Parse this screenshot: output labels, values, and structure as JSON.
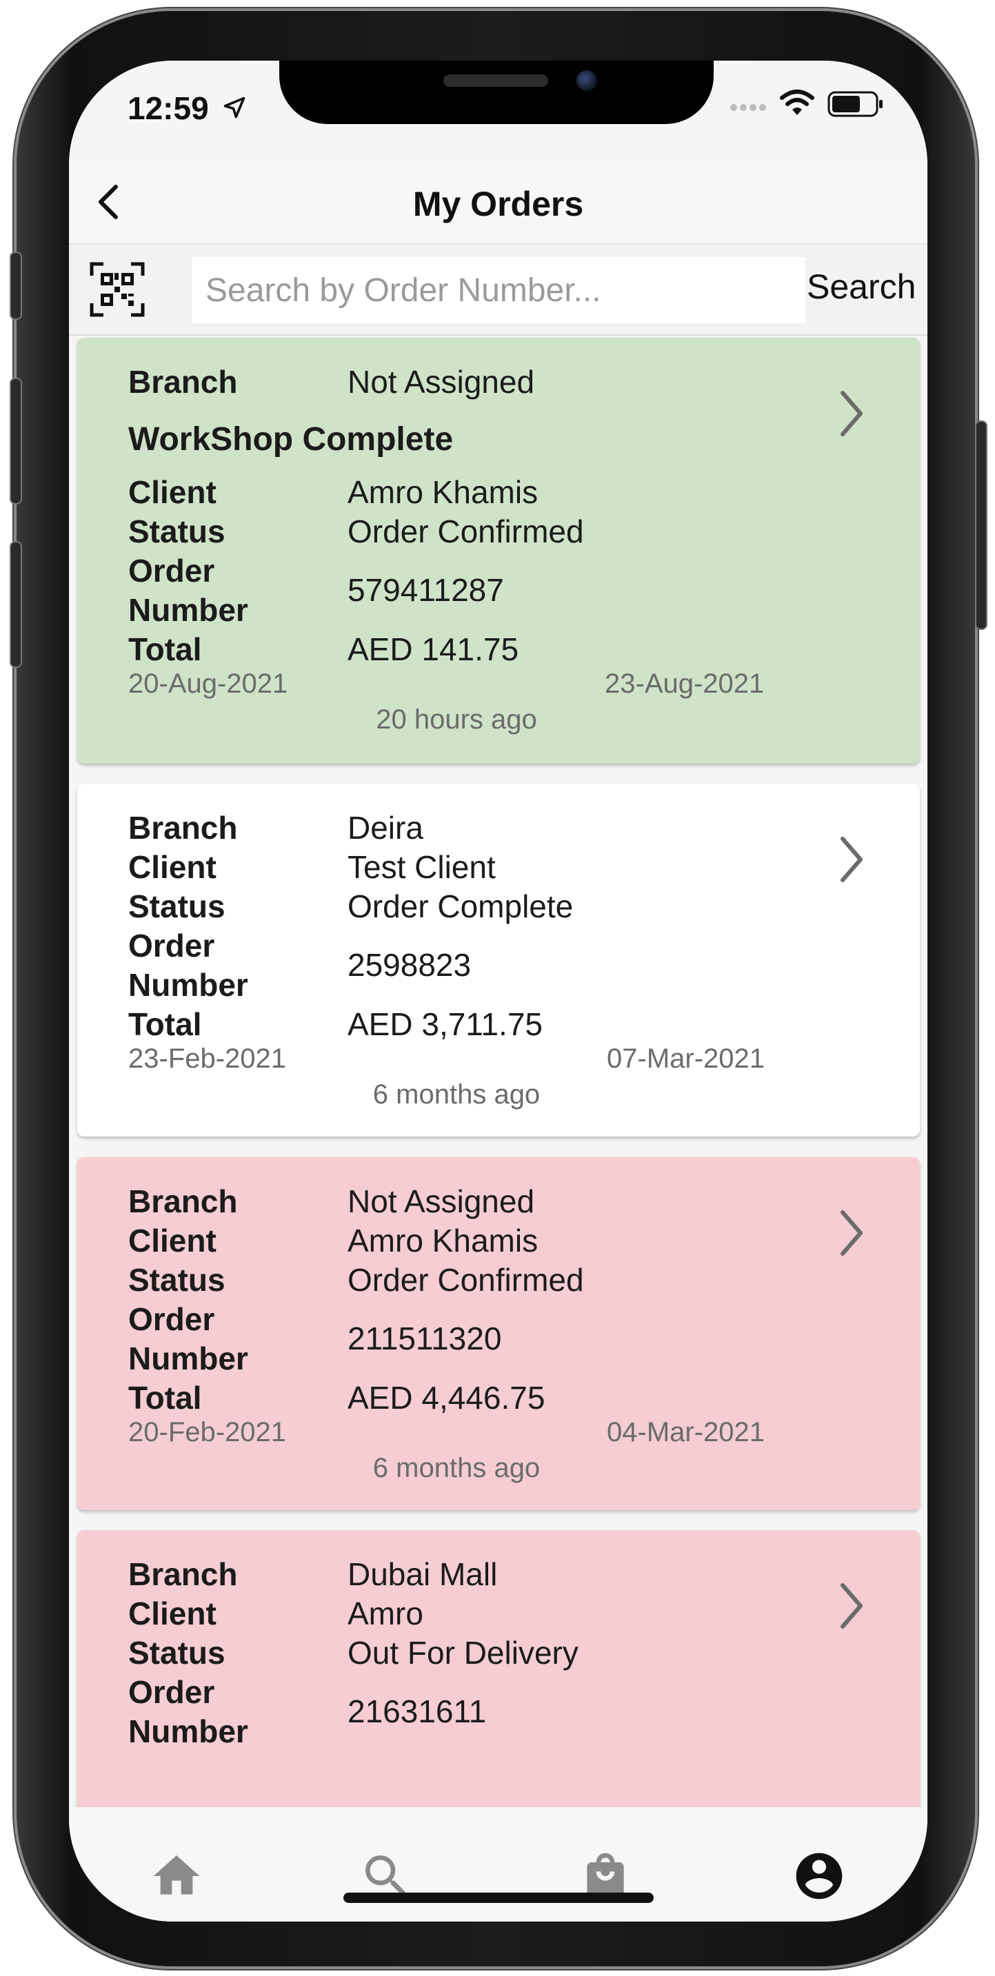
{
  "status_bar": {
    "time": "12:59"
  },
  "header": {
    "title": "My Orders"
  },
  "search": {
    "placeholder": "Search by Order Number...",
    "button_label": "Search"
  },
  "labels": {
    "branch": "Branch",
    "client": "Client",
    "status": "Status",
    "order_number_line1": "Order",
    "order_number_line2": "Number",
    "total": "Total"
  },
  "orders": [
    {
      "branch": "Not Assigned",
      "workshop_note": "WorkShop Complete",
      "client": "Amro Khamis",
      "status": "Order Confirmed",
      "order_number": "579411287",
      "total": "AED 141.75",
      "start_date": "20-Aug-2021",
      "end_date": "23-Aug-2021",
      "relative_time": "20 hours ago",
      "bg_color": "#cfe3c9"
    },
    {
      "branch": "Deira",
      "client": "Test Client",
      "status": "Order Complete",
      "order_number": "2598823",
      "total": "AED 3,711.75",
      "start_date": "23-Feb-2021",
      "end_date": "07-Mar-2021",
      "relative_time": "6 months ago",
      "bg_color": "#ffffff"
    },
    {
      "branch": "Not Assigned",
      "client": "Amro Khamis",
      "status": "Order Confirmed",
      "order_number": "211511320",
      "total": "AED 4,446.75",
      "start_date": "20-Feb-2021",
      "end_date": "04-Mar-2021",
      "relative_time": "6 months ago",
      "bg_color": "#f5cdd2"
    },
    {
      "branch": "Dubai Mall",
      "client": "Amro",
      "status": "Out For Delivery",
      "order_number": "21631611",
      "bg_color": "#f5cdd2"
    }
  ],
  "bottom_nav": [
    {
      "icon": "home-icon"
    },
    {
      "icon": "search-icon"
    },
    {
      "icon": "shopping-bag-icon"
    },
    {
      "icon": "account-icon",
      "active": true
    }
  ],
  "colors": {
    "nav_inactive": "#8a8a8a",
    "nav_active": "#111111"
  }
}
